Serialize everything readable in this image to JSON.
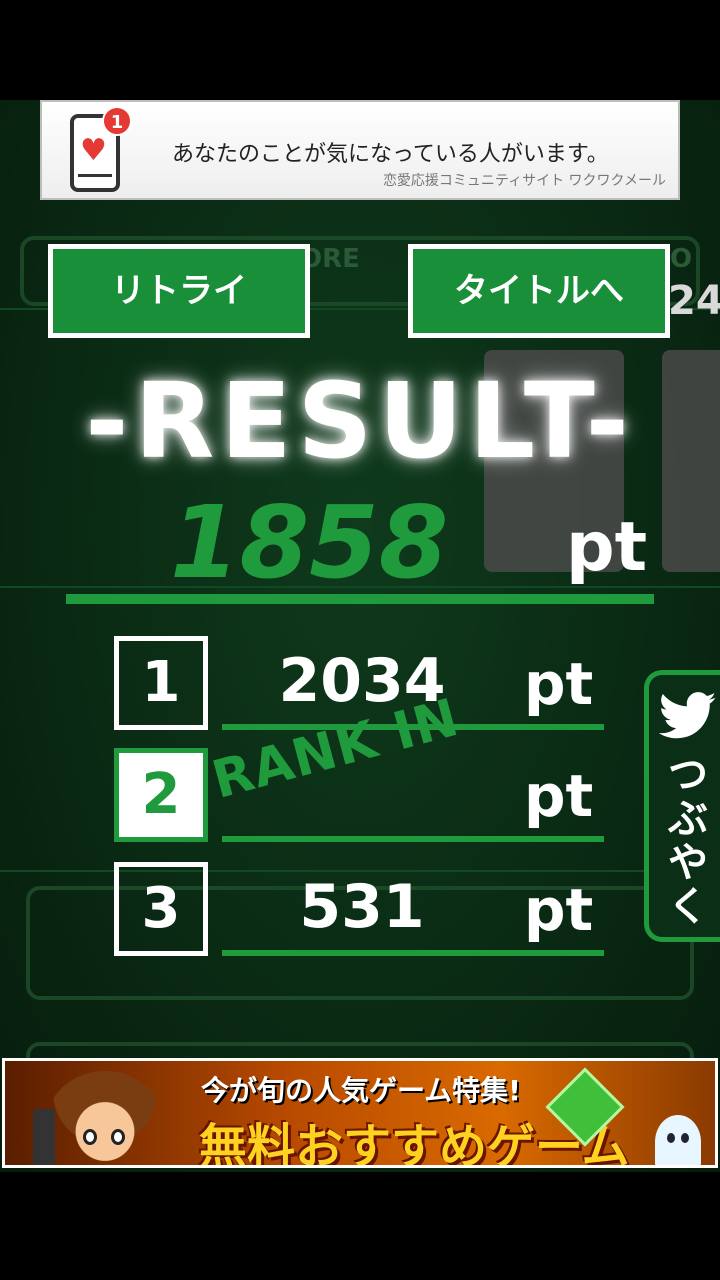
{
  "ad_top": {
    "badge": "1",
    "headline": "あなたのことが気になっている人がいます。",
    "sub": "恋愛応援コミュニティサイト ワクワクメール"
  },
  "background": {
    "label_left": "ORE",
    "label_right": "O",
    "number_right": "24"
  },
  "buttons": {
    "retry": "リトライ",
    "title": "タイトルへ"
  },
  "result": {
    "title": "-RESULT-",
    "score": "1858",
    "unit": "pt"
  },
  "ranking": [
    {
      "rank": "1",
      "score": "2034",
      "unit": "pt",
      "current": false
    },
    {
      "rank": "2",
      "score": "",
      "unit": "pt",
      "current": true
    },
    {
      "rank": "3",
      "score": "531",
      "unit": "pt",
      "current": false
    }
  ],
  "rank_in_label": "RANK IN",
  "tweet": {
    "icon": "twitter-bird-icon",
    "label": "つぶやく"
  },
  "ad_bottom": {
    "line1": "今が旬の人気ゲーム特集!",
    "line2": "無料おすすめゲーム"
  },
  "colors": {
    "accent_green": "#1f9a3c",
    "button_green": "#1a8f3a",
    "background": "#0a2a14"
  }
}
